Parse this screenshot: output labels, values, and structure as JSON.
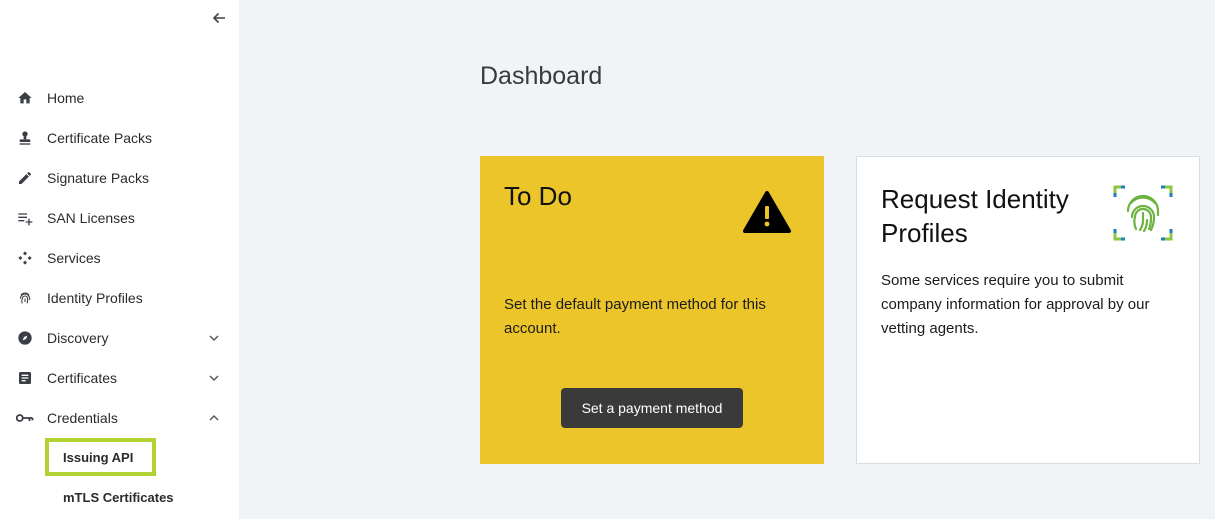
{
  "sidebar": {
    "items": [
      {
        "label": "Home"
      },
      {
        "label": "Certificate Packs"
      },
      {
        "label": "Signature Packs"
      },
      {
        "label": "SAN Licenses"
      },
      {
        "label": "Services"
      },
      {
        "label": "Identity Profiles"
      },
      {
        "label": "Discovery"
      },
      {
        "label": "Certificates"
      },
      {
        "label": "Credentials"
      }
    ],
    "credentials_sub": [
      {
        "label": "Issuing API"
      },
      {
        "label": "mTLS Certificates"
      }
    ]
  },
  "main": {
    "title": "Dashboard",
    "todo_card": {
      "title": "To Do",
      "text": "Set the default payment method for this account.",
      "button_label": "Set a payment method"
    },
    "identity_card": {
      "title": "Request Identity Profiles",
      "text": "Some services require you to submit company information for approval by our vetting agents."
    }
  },
  "colors": {
    "todo_card_bg": "#ecc52b",
    "button_bg": "#3a3a3a",
    "active_highlight": "#b2d233",
    "page_bg": "#f1f4f7"
  }
}
